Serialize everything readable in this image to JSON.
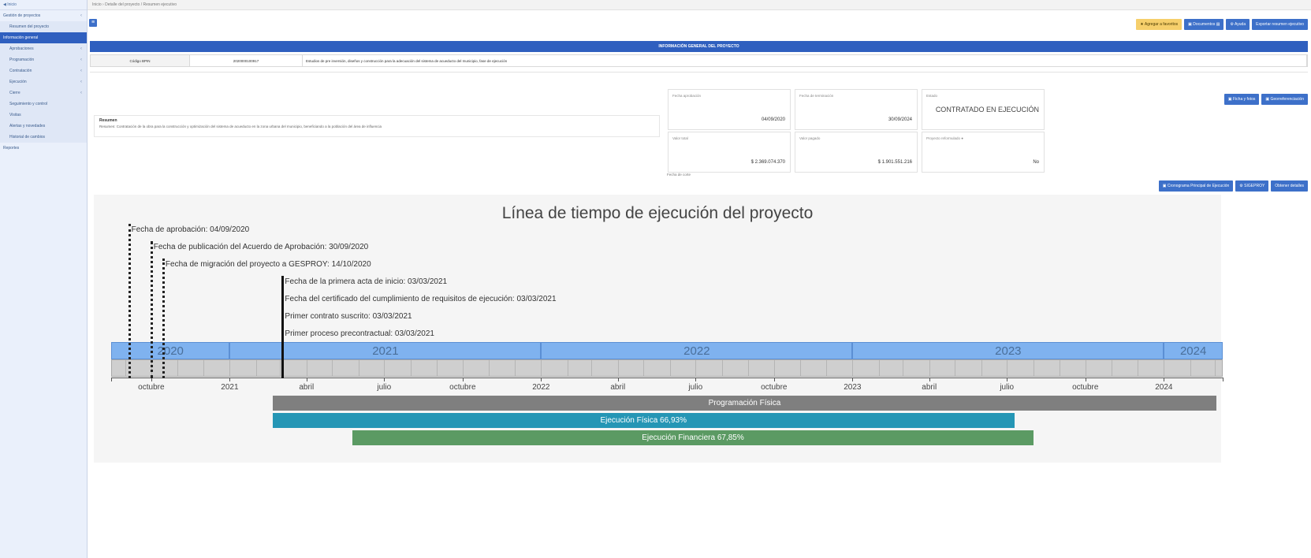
{
  "breadcrumb": "Inicio  ›  Detalle del proyecto / Resumen ejecutivo",
  "sidebar": {
    "top": "◀ Inicio",
    "items": [
      {
        "label": "Gestión de proyectos",
        "style": "plain",
        "caret": true
      },
      {
        "label": "Resumen del proyecto",
        "style": "sub",
        "caret": false
      },
      {
        "label": "Información general",
        "style": "active",
        "caret": false
      },
      {
        "label": "Aprobaciones",
        "style": "sub",
        "caret": true
      },
      {
        "label": "Programación",
        "style": "sub",
        "caret": true
      },
      {
        "label": "Contratación",
        "style": "sub",
        "caret": true
      },
      {
        "label": "Ejecución",
        "style": "sub",
        "caret": true
      },
      {
        "label": "Cierre",
        "style": "sub",
        "caret": true
      },
      {
        "label": "Seguimiento y control",
        "style": "sub",
        "caret": false
      },
      {
        "label": "Visitas",
        "style": "sub",
        "caret": false
      },
      {
        "label": "Alertas y novedades",
        "style": "sub",
        "caret": false
      },
      {
        "label": "Historial de cambios",
        "style": "sub",
        "caret": false
      },
      {
        "label": "Reportes",
        "style": "plain",
        "caret": false
      }
    ]
  },
  "menu_button": "≡",
  "toolbar": [
    {
      "label": "★ Agregar a favoritos",
      "style": "yellow"
    },
    {
      "label": "▣ Documentos ▤",
      "style": "blue"
    },
    {
      "label": "⚙ Ayuda",
      "style": "blue"
    },
    {
      "label": "Exportar resumen ejecutivo",
      "style": "blue"
    }
  ],
  "project": {
    "header": "INFORMACIÓN GENERAL DEL PROYECTO",
    "code_label": "Código BPIN",
    "code": "2020000100917",
    "name": "Estudios de pre inversión, diseños y construcción para la adecuación del sistema de acueducto del municipio, fase de ejecución"
  },
  "section_buttons": [
    "▣ Ficha y fotos",
    "▣ Georreferenciación"
  ],
  "resumen": {
    "title": "Resumen",
    "text": "Resumen: Contratación de la obra para la construcción y optimización del sistema de acueducto en la zona urbana del municipio, beneficiando a la población del área de influencia"
  },
  "cards": [
    {
      "label": "Fecha aprobación",
      "value": "04/09/2020",
      "big": false
    },
    {
      "label": "Fecha de terminación",
      "value": "30/09/2024",
      "big": false
    },
    {
      "label": "Estado",
      "value": "CONTRATADO EN EJECUCIÓN",
      "big": true
    },
    {
      "label": "Valor total",
      "value": "$ 2.369.074.370",
      "big": false
    },
    {
      "label": "Valor pagado",
      "value": "$ 1.901.551.216",
      "big": false
    },
    {
      "label": "Proyecto reformulado ●",
      "value": "No",
      "big": false
    }
  ],
  "fecha_corte": "Fecha de corte",
  "section_buttons_2": [
    "▣ Cronograma Principal de Ejecución",
    "⚙ SIGEPROY",
    "Obtener detalles"
  ],
  "timeline": {
    "title": "Línea de tiempo de ejecución del proyecto",
    "events": [
      {
        "label": "Fecha de aprobación: 04/09/2020",
        "date": "2020-09-04"
      },
      {
        "label": "Fecha de publicación del Acuerdo de Aprobación: 30/09/2020",
        "date": "2020-09-30"
      },
      {
        "label": "Fecha de migración del proyecto a GESPROY: 14/10/2020",
        "date": "2020-10-14"
      },
      {
        "label": "Fecha de la primera acta de inicio: 03/03/2021",
        "date": "2021-03-03"
      },
      {
        "label": "Fecha del certificado del cumplimiento de requisitos de ejecución: 03/03/2021",
        "date": "2021-03-03"
      },
      {
        "label": "Primer contrato suscrito: 03/03/2021",
        "date": "2021-03-03"
      },
      {
        "label": "Primer proceso precontractual: 03/03/2021",
        "date": "2021-03-03"
      }
    ],
    "years": [
      "2020",
      "2021",
      "2022",
      "2023",
      "2024"
    ],
    "axis_labels": [
      "octubre",
      "2021",
      "abril",
      "julio",
      "octubre",
      "2022",
      "abril",
      "julio",
      "octubre",
      "2023",
      "abril",
      "julio",
      "octubre",
      "2024"
    ],
    "bars": [
      {
        "label": "Programación Física",
        "start": "2021-02-20",
        "end": "2024-03-03",
        "color": "#7f7f7f"
      },
      {
        "label": "Ejecución Física 66,93%",
        "start": "2021-02-20",
        "end": "2023-07-10",
        "color": "#2596b5"
      },
      {
        "label": "Ejecución Financiera 67,85%",
        "start": "2021-05-25",
        "end": "2023-08-01",
        "color": "#5b9a63"
      }
    ]
  }
}
